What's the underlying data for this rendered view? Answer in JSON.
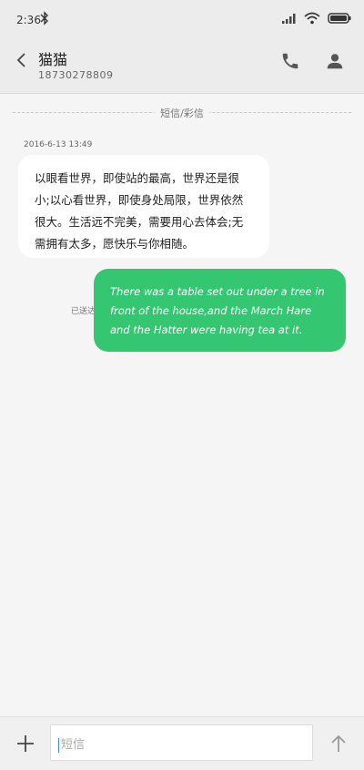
{
  "status": {
    "time": "2:36"
  },
  "header": {
    "name": "猫猫",
    "number": "18730278809"
  },
  "carrier": {
    "label": "短信/彩信"
  },
  "messages": {
    "incoming": {
      "timestamp": "2016-6-13 13:49",
      "text": "以眼看世界，即使站的最高，世界还是很小;以心看世界，即使身处局限，世界依然很大。生活远不完美，需要用心去体会;无需拥有太多，愿快乐与你相随。"
    },
    "outgoing": {
      "status": "已送达",
      "text": "There was a table set out under a tree in front of the house,and the March Hare and the Hatter were having tea at it."
    }
  },
  "composer": {
    "placeholder": "短信"
  },
  "colors": {
    "accent": "#35c672",
    "cursor": "#3a8dde"
  }
}
